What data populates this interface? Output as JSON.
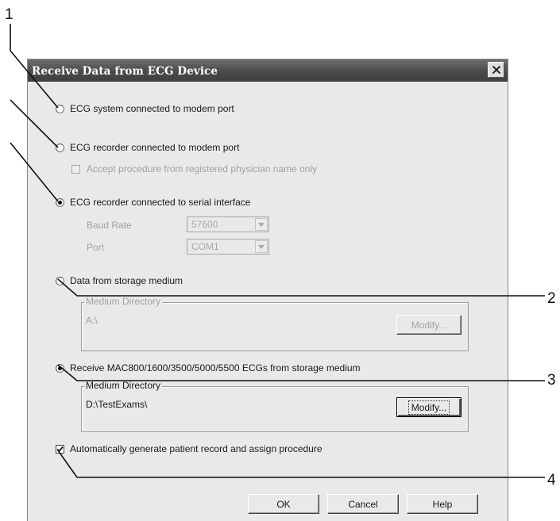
{
  "callouts": [
    "1",
    "2",
    "3",
    "4"
  ],
  "dialog": {
    "title": "Receive Data from ECG Device",
    "close_icon": "close-icon",
    "options": {
      "modem_system_label": "ECG system connected to modem port",
      "modem_recorder_label": "ECG recorder connected to modem port",
      "accept_registered_label": "Accept procedure from registered physician name only",
      "serial_label": "ECG recorder connected to serial interface",
      "baud_rate_label": "Baud Rate",
      "baud_rate_value": "57600",
      "port_label": "Port",
      "port_value": "COM1",
      "storage_label": "Data from storage medium",
      "storage_group_label": "Medium Directory",
      "storage_directory": "A:\\",
      "storage_modify": "Modify...",
      "mac_label": "Receive MAC800/1600/3500/5000/5500 ECGs from storage medium",
      "mac_group_label": "Medium Directory",
      "mac_directory": "D:\\TestExams\\",
      "mac_modify": "Modify...",
      "auto_generate_label": "Automatically generate patient record and assign procedure"
    },
    "state": {
      "selected_radio": "ECG recorder connected to serial interface",
      "auto_generate_checked": true,
      "accept_registered_checked": false
    },
    "buttons": {
      "ok": "OK",
      "cancel": "Cancel",
      "help": "Help"
    }
  }
}
